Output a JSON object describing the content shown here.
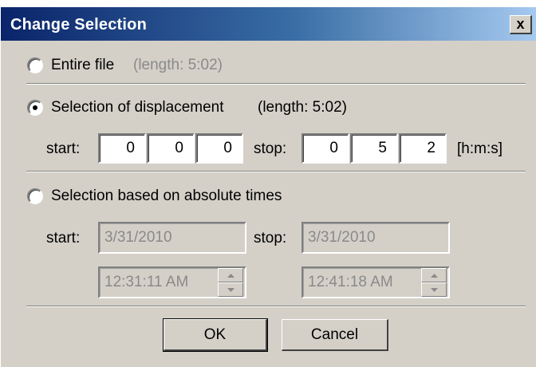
{
  "window": {
    "title": "Change Selection",
    "close_glyph": "x"
  },
  "entire_file": {
    "label": "Entire file",
    "length_note": "(length: 5:02)",
    "selected": false
  },
  "displacement": {
    "label": "Selection of displacement",
    "length_note": "(length: 5:02)",
    "selected": true,
    "start_label": "start:",
    "start_h": "0",
    "start_m": "0",
    "start_s": "0",
    "stop_label": "stop:",
    "stop_h": "0",
    "stop_m": "5",
    "stop_s": "2",
    "units": "[h:m:s]"
  },
  "absolute": {
    "label": "Selection based on absolute times",
    "selected": false,
    "start_label": "start:",
    "start_date": "3/31/2010",
    "start_time": "12:31:11 AM",
    "stop_label": "stop:",
    "stop_date": "3/31/2010",
    "stop_time": "12:41:18 AM"
  },
  "buttons": {
    "ok": "OK",
    "cancel": "Cancel"
  }
}
